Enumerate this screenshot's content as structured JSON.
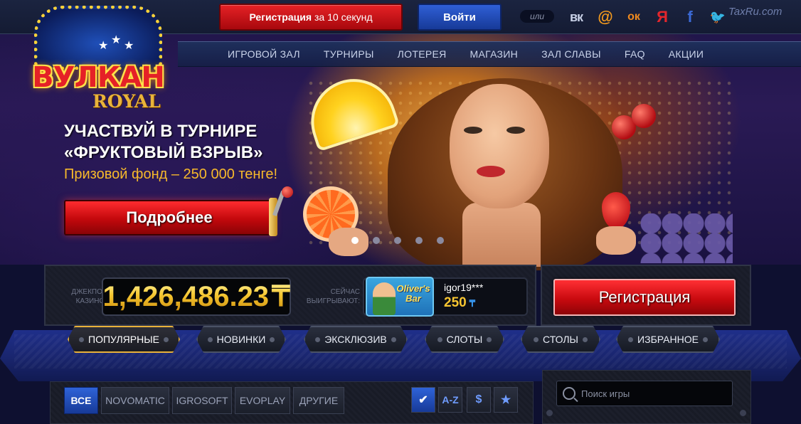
{
  "header": {
    "register_bold": "Регистрация",
    "register_rest": "за 10 секунд",
    "login": "Войти",
    "or": "или",
    "social": [
      {
        "icon": "vk-icon",
        "glyph": "вк",
        "color": "#c7d0e6"
      },
      {
        "icon": "mail-icon",
        "glyph": "@",
        "color": "#f39a1e"
      },
      {
        "icon": "odnoklassniki-icon",
        "glyph": "ок",
        "color": "#f08a1e"
      },
      {
        "icon": "yandex-icon",
        "glyph": "Я",
        "color": "#e3262c"
      },
      {
        "icon": "facebook-icon",
        "glyph": "f",
        "color": "#3b6ad6"
      },
      {
        "icon": "twitter-icon",
        "glyph": "🐦",
        "color": "#3aa0ee"
      }
    ],
    "watermark": "TaxRu.com"
  },
  "nav": {
    "items": [
      "ИГРОВОЙ ЗАЛ",
      "ТУРНИРЫ",
      "ЛОТЕРЕЯ",
      "МАГАЗИН",
      "ЗАЛ СЛАВЫ",
      "FAQ",
      "АКЦИИ"
    ]
  },
  "logo": {
    "title": "ВУЛКАН",
    "subtitle": "ROYAL"
  },
  "promo": {
    "title_line1": "УЧАСТВУЙ В ТУРНИРЕ",
    "title_line2": "«ФРУКТОВЫЙ ВЗРЫВ»",
    "prize": "Призовой фонд – 250 000 тенге!",
    "button": "Подробнее",
    "slides_total": 5,
    "slide_active": 1
  },
  "jackpot": {
    "label": "ДЖЕКПОТ КАЗИНО:",
    "value": "1,426,486.23",
    "currency": "₸"
  },
  "winners": {
    "label": "СЕЙЧАС ВЫИГРЫВАЮТ:",
    "game_name": "Oliver's Bar",
    "user": "igor19***",
    "amount": "250",
    "currency": "₸"
  },
  "register_big": "Регистрация",
  "categories": [
    "ПОПУЛЯРНЫЕ",
    "НОВИНКИ",
    "ЭКСКЛЮЗИВ",
    "СЛОТЫ",
    "СТОЛЫ",
    "ИЗБРАННОЕ"
  ],
  "active_category": "ПОПУЛЯРНЫЕ",
  "providers": [
    "ВСЕ",
    "NOVOMATIC",
    "IGROSOFT",
    "EVOPLAY",
    "ДРУГИЕ"
  ],
  "active_provider": "ВСЕ",
  "sort_buttons": [
    {
      "icon": "check-icon",
      "glyph": "✔"
    },
    {
      "icon": "sort-az-icon",
      "glyph": "A-Z"
    },
    {
      "icon": "dollar-icon",
      "glyph": "$"
    },
    {
      "icon": "star-icon",
      "glyph": "★"
    }
  ],
  "search": {
    "placeholder": "Поиск игры"
  },
  "colors": {
    "accent_red": "#d3151a",
    "accent_blue": "#2f5fd6",
    "gold": "#f7c531"
  }
}
